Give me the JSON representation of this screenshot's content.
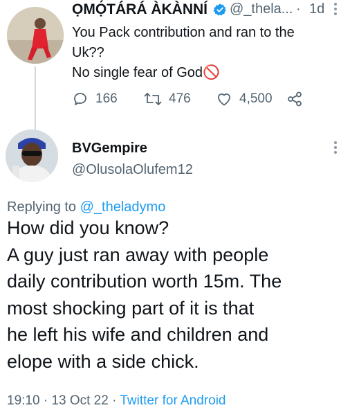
{
  "tweet1": {
    "author_name": "ỌMỌ́TÁRÁ ÀKÀNNÍ",
    "handle": "@_thela...",
    "separator": "·",
    "time": "1d",
    "lines": [
      "You Pack contribution and ran to the",
      "Uk??",
      "No single fear of God🚫"
    ],
    "replies": "166",
    "retweets": "476",
    "likes": "4,500"
  },
  "tweet2": {
    "author_name": "BVGempire",
    "handle": "@OlusolaOlufem12",
    "replying_prefix": "Replying to",
    "replying_to": "@_theladymo",
    "lines": [
      "How did you know?",
      "A guy just ran away with people",
      "daily contribution worth 15m. The",
      "most  shocking part of it is that",
      "he left his wife and children and",
      "elope with a side chick."
    ],
    "time": "19:10",
    "date": "13 Oct 22",
    "separator": "·",
    "source": "Twitter for Android"
  },
  "colors": {
    "text": "#0f1419",
    "secondary": "#536471",
    "accent": "#1d9bf0"
  }
}
